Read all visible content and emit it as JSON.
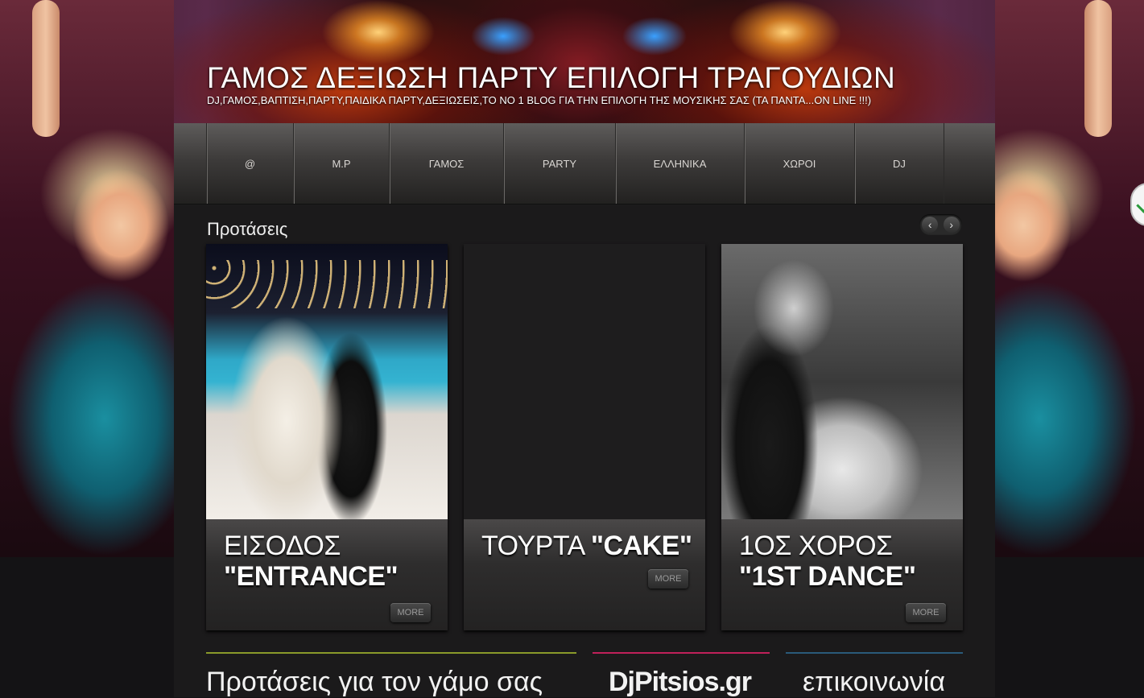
{
  "header": {
    "title": "ΓΑΜΟΣ ΔΕΞΙΩΣΗ ΠΑΡΤΥ ΕΠΙΛΟΓΗ ΤΡΑΓΟΥΔΙΩΝ",
    "description": "DJ,ΓΑΜΟΣ,ΒΑΠΤΙΣΗ,ΠΑΡΤΥ,ΠΑΙΔΙΚΑ ΠΑΡΤΥ,ΔΕΞΙΩΣΕΙΣ,ΤΟ ΝΟ 1 BLOG ΓΙΑ ΤΗΝ ΕΠΙΛΟΓΗ ΤΗΣ ΜΟΥΣΙΚΗΣ ΣΑΣ (ΤΑ ΠΑΝΤΑ...ON LINE !!!)"
  },
  "nav": {
    "items": [
      {
        "label": "@"
      },
      {
        "label": "Μ.Ρ"
      },
      {
        "label": "ΓΑΜΟΣ"
      },
      {
        "label": "PARTY"
      },
      {
        "label": "ΕΛΛΗΝΙΚΑ"
      },
      {
        "label": "ΧΩΡΟΙ"
      },
      {
        "label": "DJ"
      }
    ]
  },
  "featured": {
    "title": "Προτάσεις",
    "prev_arrow": "‹",
    "next_arrow": "›",
    "cards": [
      {
        "title_line1": "ΕΙΣΟΔΟΣ",
        "title_line2": "\"ENTRANCE\"",
        "more": "MORE"
      },
      {
        "title_line1": "ΤΟΥΡΤΑ",
        "title_line2": "\"CAKE\"",
        "more": "MORE"
      },
      {
        "title_line1": "1ΟΣ ΧΟΡΟΣ",
        "title_line2": "\"1ST DANCE\"",
        "more": "MORE"
      }
    ]
  },
  "footer": {
    "col1": "Προτάσεις για τον γάμο σας",
    "col2": "DjPitsios.gr",
    "col3": "επικοινωνία"
  },
  "colors": {
    "page_bg": "#141315",
    "line1": "#8a9a2a",
    "line2": "#c0205a",
    "line3": "#2a5a7a"
  }
}
